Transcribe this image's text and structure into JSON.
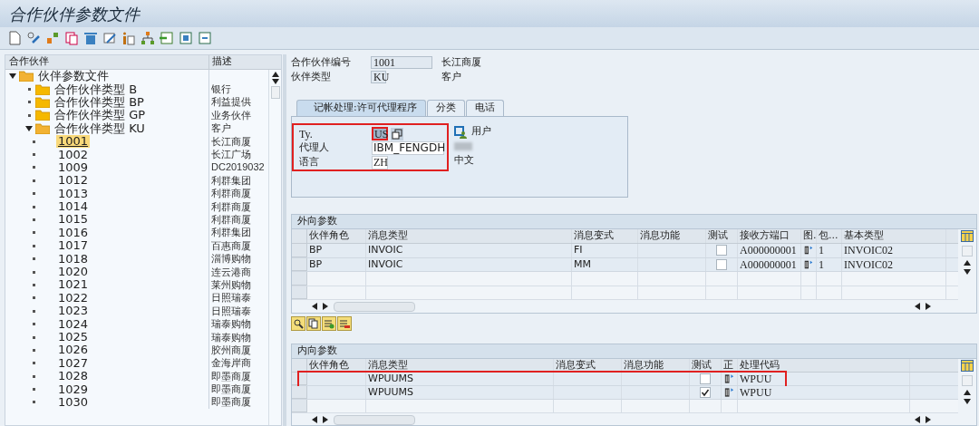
{
  "window": {
    "title": "合作伙伴参数文件"
  },
  "tree": {
    "columns": [
      "合作伙伴",
      "描述"
    ],
    "items": [
      {
        "label": "伙伴参数文件",
        "expanded": true,
        "children": [
          {
            "label": "合作伙伴类型 B",
            "description": "银行",
            "expanded": false
          },
          {
            "label": "合作伙伴类型 BP",
            "description": "利益提供",
            "expanded": false
          },
          {
            "label": "合作伙伴类型 GP",
            "description": "业务伙伴",
            "expanded": false
          },
          {
            "label": "合作伙伴类型 KU",
            "description": "客户",
            "expanded": true,
            "children": [
              {
                "label": "1001",
                "description": "长江商厦",
                "selected": true
              },
              {
                "label": "1002",
                "description": "长江广场",
                "selected": false
              },
              {
                "label": "1009",
                "description": "DC2019032",
                "selected": false
              },
              {
                "label": "1012",
                "description": "利群集团",
                "selected": false
              },
              {
                "label": "1013",
                "description": "利群商厦",
                "selected": false
              },
              {
                "label": "1014",
                "description": "利群商厦",
                "selected": false
              },
              {
                "label": "1015",
                "description": "利群商厦",
                "selected": false
              },
              {
                "label": "1016",
                "description": "利群集团",
                "selected": false
              },
              {
                "label": "1017",
                "description": "百惠商厦",
                "selected": false
              },
              {
                "label": "1018",
                "description": "淄博购物",
                "selected": false
              },
              {
                "label": "1020",
                "description": "连云港商",
                "selected": false
              },
              {
                "label": "1021",
                "description": "莱州购物",
                "selected": false
              },
              {
                "label": "1022",
                "description": "日照瑞泰",
                "selected": false
              },
              {
                "label": "1023",
                "description": "日照瑞泰",
                "selected": false
              },
              {
                "label": "1024",
                "description": "瑞泰购物",
                "selected": false
              },
              {
                "label": "1025",
                "description": "瑞泰购物",
                "selected": false
              },
              {
                "label": "1026",
                "description": "胶州商厦",
                "selected": false
              },
              {
                "label": "1027",
                "description": "金海岸商",
                "selected": false
              },
              {
                "label": "1028",
                "description": "即墨商厦",
                "selected": false
              },
              {
                "label": "1029",
                "description": "即墨商厦",
                "selected": false
              },
              {
                "label": "1030",
                "description": "即墨商厦",
                "selected": false
              }
            ]
          }
        ]
      }
    ]
  },
  "header": {
    "fields": [
      {
        "label": "合作伙伴编号",
        "value": "1001",
        "description": "长江商厦"
      },
      {
        "label": "伙伴类型",
        "value": "KU",
        "description": "客户"
      }
    ]
  },
  "tabs": [
    {
      "label": "记帐处理:许可代理程序",
      "selected": true
    },
    {
      "label": "分类",
      "selected": false
    },
    {
      "label": "电话",
      "selected": false
    }
  ],
  "agent": {
    "highlighted": true,
    "fields": [
      {
        "label": "Ty.",
        "value": "US",
        "focused": true,
        "description": "用户"
      },
      {
        "label": "代理人",
        "value": "IBM_FENGDH",
        "focused": false
      },
      {
        "label": "语言",
        "value": "ZH",
        "focused": false,
        "description": "中文"
      }
    ]
  },
  "outbound": {
    "title": "外向参数",
    "columns": [
      "伙伴角色",
      "消息类型",
      "消息变式",
      "消息功能",
      "测试",
      "接收方端口",
      "图.",
      "包...",
      "基本类型"
    ],
    "rows": [
      {
        "partner_role": "BP",
        "message_type": "INVOIC",
        "variant": "FI",
        "test": false,
        "port": "A000000001",
        "pack": "1",
        "basic_type": "INVOIC02"
      },
      {
        "partner_role": "BP",
        "message_type": "INVOIC",
        "variant": "MM",
        "test": false,
        "port": "A000000001",
        "pack": "1",
        "basic_type": "INVOIC02"
      }
    ]
  },
  "inbound": {
    "title": "内向参数",
    "columns": [
      "伙伴角色",
      "消息类型",
      "消息变式",
      "消息功能",
      "测试",
      "正",
      "处理代码"
    ],
    "rows": [
      {
        "message_type": "WPUUMS",
        "test": false,
        "process_code": "WPUU",
        "highlighted": true
      },
      {
        "message_type": "WPUUMS",
        "test": true,
        "process_code": "WPUU",
        "highlighted": false
      }
    ]
  }
}
